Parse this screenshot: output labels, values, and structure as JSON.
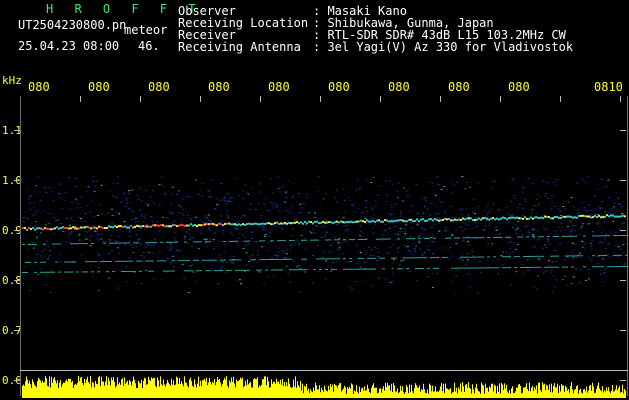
{
  "header": {
    "brand": "H R O F F T",
    "filename": "UT2504230800.pn",
    "filename_suffix": "meteor",
    "datetime": "25.04.23 08:00",
    "count": "46."
  },
  "meta": [
    {
      "label": "Observer",
      "value": ": Masaki Kano"
    },
    {
      "label": "Receiving Location",
      "value": ": Shibukawa, Gunma, Japan"
    },
    {
      "label": "Receiver",
      "value": ": RTL-SDR SDR# 43dB L15 103.2MHz CW"
    },
    {
      "label": "Receiving Antenna",
      "value": ": 3el Yagi(V) Az 330 for Vladivostok"
    }
  ],
  "x_axis": {
    "ticks": [
      "080",
      "080",
      "080",
      "080",
      "080",
      "080",
      "080",
      "080",
      "080",
      "0810"
    ]
  },
  "y_axis": {
    "unit": "kHz",
    "ticks": [
      "1.1",
      "1.0",
      "0.9",
      "0.8",
      "0.7",
      "0.6"
    ]
  },
  "colors": {
    "text_header": "#3ee86a",
    "text_meta": "#ffffff",
    "text_axis": "#ffff33",
    "signal_low": "#1e3aa8",
    "signal_mid": "#39c6c6",
    "signal_high": "#ffe23a",
    "signal_peak": "#ff3a3a",
    "power_bar": "#ffff00"
  }
}
